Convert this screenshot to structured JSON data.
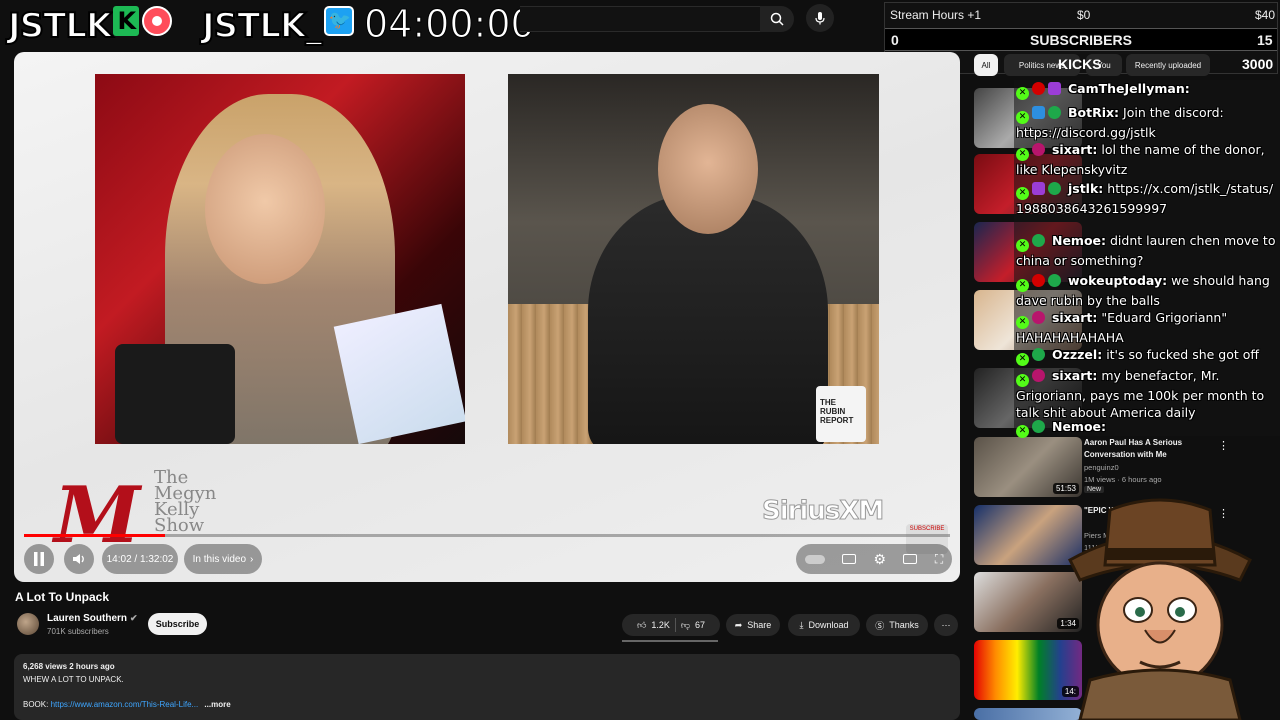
{
  "overlay": {
    "logo1": "JSTLK",
    "logo1_badge": "K",
    "logo2": "JSTLK_",
    "timer": "04:00:00"
  },
  "stats": {
    "stream_hours": "Stream Hours +1",
    "goal_current": "$0",
    "goal_target": "$40",
    "subscribers_left": "0",
    "subscribers_label": "SUBSCRIBERS",
    "subscribers_right": "15",
    "kicks_progress": "0",
    "kicks_label": "KICKS",
    "kicks_goal": "3000"
  },
  "chips": {
    "all": "All",
    "politics": "Politics news",
    "you": "You",
    "recent": "Recently uploaded"
  },
  "player": {
    "show_logo": "M",
    "show_title": "The Megyn Kelly Show",
    "sponsor": "SiriusXM",
    "watermark": "SUBSCRIBE",
    "mug_text": "THE RUBIN REPORT",
    "time": "14:02 / 1:32:02",
    "chapter": "In this video",
    "progress_fraction": 0.152
  },
  "video": {
    "title": "A Lot To Unpack",
    "channel": "Lauren Southern",
    "subscribers": "701K subscribers",
    "subscribe": "Subscribe",
    "likes": "1.2K",
    "dislikes": "67",
    "share": "Share",
    "download": "Download",
    "thanks": "Thanks"
  },
  "description": {
    "meta": "6,268 views  2 hours ago",
    "line1": "WHEW A LOT TO UNPACK.",
    "book_label": "BOOK:",
    "book_link": "https://www.amazon.com/This-Real-Life...",
    "more": "...more"
  },
  "chat": [
    {
      "user": "CamTheJellyman:",
      "text": ""
    },
    {
      "user": "BotRix:",
      "text": "Join the discord: https://discord.gg/jstlk"
    },
    {
      "user": "sixart:",
      "text": "lol the name of the donor, like Klepenskyvitz"
    },
    {
      "user": "jstlk:",
      "text": "https://x.com/jstlk_/status/1988038643261599997"
    },
    {
      "user": "Nemoe:",
      "text": "didnt lauren chen move to china or something?"
    },
    {
      "user": "wokeuptoday:",
      "text": "we should hang dave rubin by the balls"
    },
    {
      "user": "sixart:",
      "text": "\"Eduard Grigoriann\" HAHAHAHAHAHA"
    },
    {
      "user": "Ozzzel:",
      "text": "it's so fucked she got off"
    },
    {
      "user": "sixart:",
      "text": "my benefactor, Mr. Grigoriann, pays me 100k per month to talk shit about America daily"
    },
    {
      "user": "Nemoe:",
      "text": ""
    }
  ],
  "recommended": [
    {
      "title": "Aaron Paul Has A Serious Conversation with Me",
      "channel": "penguinz0",
      "meta": "1M views · 6 hours ago",
      "badge": "New",
      "duration": "51:53"
    },
    {
      "title": "\"EPIC W... BBC Lawsu...",
      "channel": "Piers M...",
      "meta": "111K v...",
      "badge": "",
      "duration": ""
    },
    {
      "title": "",
      "channel": "",
      "meta": "",
      "badge": "",
      "duration": "1:34"
    },
    {
      "title": "",
      "channel": "",
      "meta": "",
      "badge": "",
      "duration": "14:"
    }
  ],
  "colors": {
    "yt_bg": "#0f0f0f",
    "yt_red": "#ff0000",
    "kick_green": "#53fc18",
    "link_blue": "#3ea6ff"
  }
}
